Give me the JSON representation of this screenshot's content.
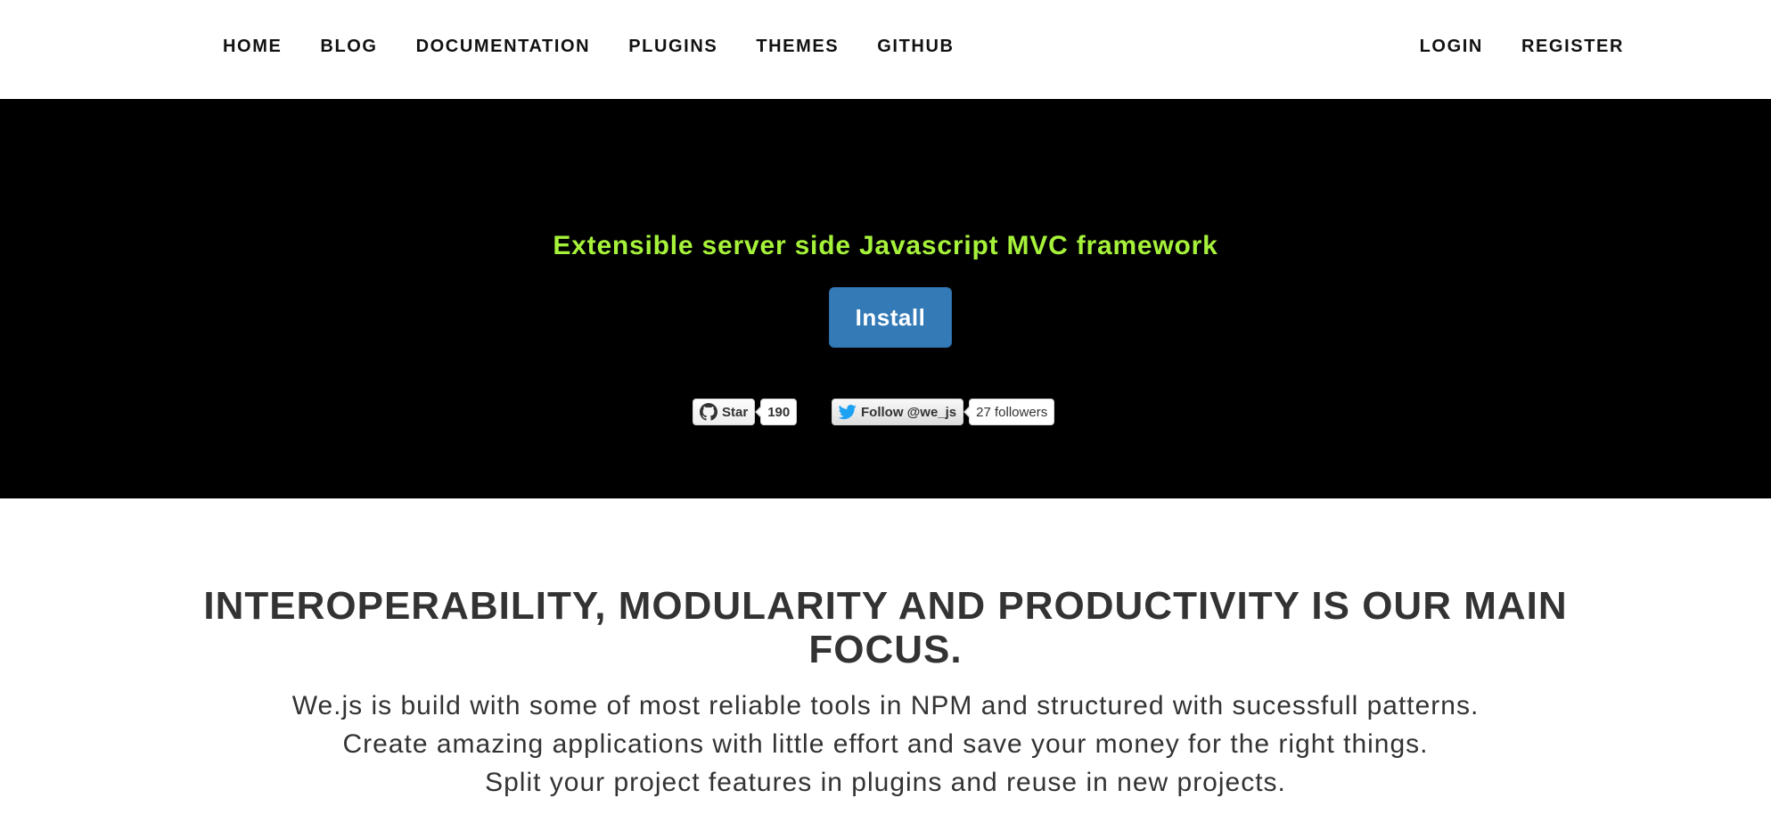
{
  "nav": {
    "left": [
      {
        "id": "home",
        "label": "HOME"
      },
      {
        "id": "blog",
        "label": "BLOG"
      },
      {
        "id": "documentation",
        "label": "DOCUMENTATION"
      },
      {
        "id": "plugins",
        "label": "PLUGINS"
      },
      {
        "id": "themes",
        "label": "THEMES"
      },
      {
        "id": "github",
        "label": "GITHUB"
      }
    ],
    "right": [
      {
        "id": "login",
        "label": "LOGIN"
      },
      {
        "id": "register",
        "label": "REGISTER"
      }
    ]
  },
  "hero": {
    "tagline": "Extensible server side Javascript MVC framework",
    "install_label": "Install",
    "github_star": {
      "label": "Star",
      "count": "190",
      "icon": "github-icon"
    },
    "twitter_follow": {
      "label": "Follow @we_js",
      "count": "27 followers",
      "icon": "twitter-icon"
    }
  },
  "focus": {
    "title": "INTEROPERABILITY, MODULARITY AND PRODUCTIVITY IS OUR MAIN FOCUS.",
    "lines": [
      "We.js is build with some of most reliable tools in NPM and structured with sucessfull patterns.",
      "Create amazing applications with little effort and save your money for the right things.",
      "Split your project features in plugins and reuse in new projects."
    ]
  },
  "colors": {
    "hero_background": "#000000",
    "tagline": "#a6f23a",
    "install_button": "#337ab7",
    "twitter_blue": "#1da1f2",
    "text": "#333333"
  }
}
